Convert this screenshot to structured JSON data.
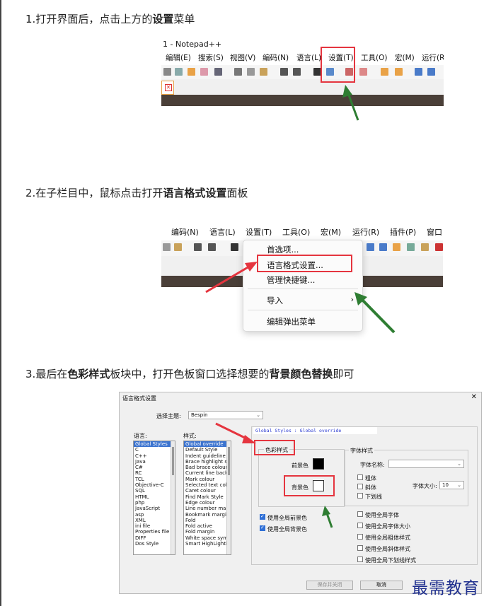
{
  "steps": [
    {
      "number": "1.",
      "pre": "打开界面后，点击上方的",
      "bold": "设置",
      "post": "菜单"
    },
    {
      "number": "2.",
      "pre": "在子栏目中，鼠标点击打开",
      "bold": "语言格式设置",
      "post": "面板"
    },
    {
      "number": "3.",
      "pre": "最后在",
      "bold": "色彩样式",
      "mid": "板块中，打开色板窗口选择想要的",
      "bold2": "背景颜色替换",
      "post": "即可"
    }
  ],
  "shot1": {
    "title": "1 - Notepad++",
    "menus": [
      "编辑(E)",
      "搜索(S)",
      "视图(V)",
      "编码(N)",
      "语言(L)",
      "设置(T)",
      "工具(O)",
      "宏(M)",
      "运行(R"
    ]
  },
  "shot2": {
    "menus": [
      "编码(N)",
      "语言(L)",
      "设置(T)",
      "工具(O)",
      "宏(M)",
      "运行(R)",
      "插件(P)",
      "窗口"
    ],
    "context_menu": {
      "items": [
        "首选项...",
        "语言格式设置...",
        "管理快捷键...",
        "导入",
        "编辑弹出菜单"
      ],
      "submenu_arrow": "›"
    }
  },
  "dialog": {
    "title": "语言格式设置",
    "close": "✕",
    "theme_label": "选择主题:",
    "theme_value": "Bespin",
    "language_label": "语言:",
    "style_label": "样式:",
    "languages": [
      "Global Styles",
      "C",
      "C++",
      "Java",
      "C#",
      "RC",
      "TCL",
      "Objective-C",
      "SQL",
      "HTML",
      "php",
      "JavaScript",
      "asp",
      "XML",
      "ini file",
      "Properties file",
      "DIFF",
      "Dos Style"
    ],
    "styles": [
      "Global override",
      "Default Style",
      "Indent guideline st",
      "Brace highlight styl",
      "Bad brace colour",
      "Current line backgr",
      "Mark colour",
      "Selected text colou",
      "Caret colour",
      "Find Mark Style",
      "Edge colour",
      "Line number margin",
      "Bookmark margin",
      "Fold",
      "Fold active",
      "Fold margin",
      "White space symbo",
      "Smart HighLighting"
    ],
    "global_header": "Global Styles : Global override",
    "color_group": "色彩样式",
    "fg_label": "前景色",
    "bg_label": "背景色",
    "fg_color": "#000000",
    "bg_color": "#ffffff",
    "use_global_fg": "使用全局前景色",
    "use_global_bg": "使用全局背景色",
    "font_group": "字体样式",
    "font_name_label": "字体名称:",
    "bold": "粗体",
    "italic": "斜体",
    "underline": "下划线",
    "font_size_label": "字体大小:",
    "font_size_value": "10",
    "global_font": "使用全局字体",
    "global_font_size": "使用全局字体大小",
    "global_bold": "使用全局粗体样式",
    "global_italic": "使用全局斜体样式",
    "global_underline": "使用全局下划线样式",
    "save_close": "保存并关闭",
    "cancel": "取消"
  },
  "watermark": "最需教育",
  "colors": {
    "highlight": "#e5353f",
    "arrow": "#2e7d32",
    "selection": "#3b73cf"
  }
}
